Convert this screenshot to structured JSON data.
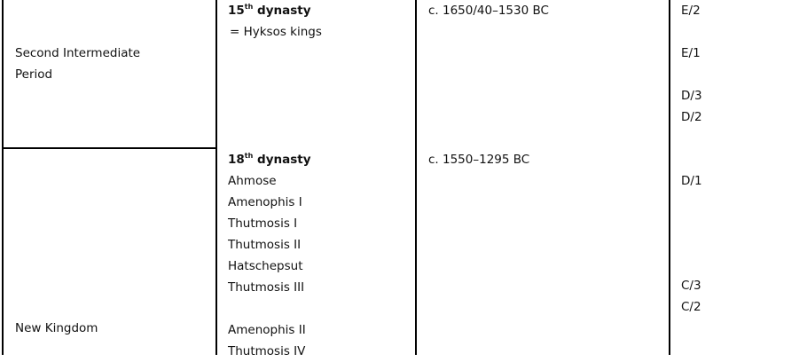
{
  "periods": {
    "second_intermediate": {
      "line1": "Second Intermediate",
      "line2": "Period"
    },
    "new_kingdom": "New Kingdom"
  },
  "dynasties": {
    "d15": {
      "number": "15",
      "suffix": "th",
      "word": " dynasty",
      "note": "= Hyksos kings",
      "dates": "c. 1650/40–1530 BC"
    },
    "d18": {
      "number": "18",
      "suffix": "th",
      "word": " dynasty",
      "dates": "c. 1550–1295 BC",
      "kings": [
        "Ahmose",
        "Amenophis I",
        "Thutmosis I",
        "Thutmosis II",
        "Hatschepsut",
        "Thutmosis III",
        "Amenophis II",
        "Thutmosis IV"
      ]
    }
  },
  "strata": [
    "E/2",
    "E/1",
    "D/3",
    "D/2",
    "D/1",
    "C/3",
    "C/2"
  ]
}
